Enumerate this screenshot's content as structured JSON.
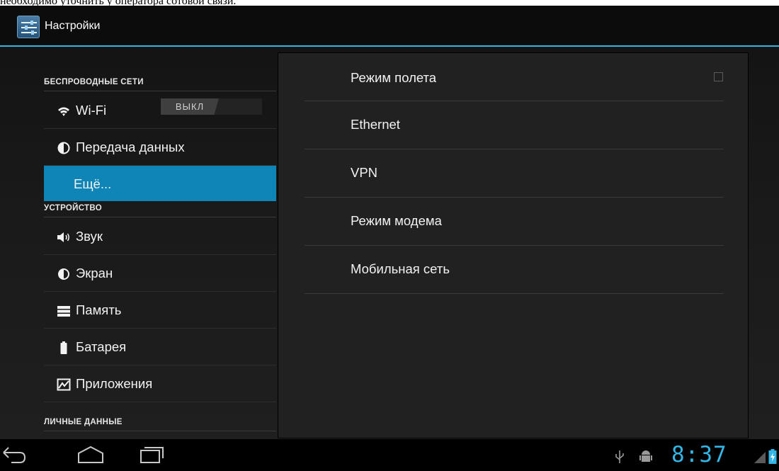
{
  "caption": "необходимо уточнить у оператора сотовой связи.",
  "app": {
    "title": "Настройки",
    "icon": "settings-icon"
  },
  "left": {
    "section_wireless": "БЕСПРОВОДНЫЕ СЕТИ",
    "wifi": {
      "label": "Wi-Fi",
      "toggle": "ВЫКЛ"
    },
    "data_usage": "Передача данных",
    "more": "Ещё...",
    "section_device": "УСТРОЙСТВО",
    "sound": "Звук",
    "display": "Экран",
    "storage": "Память",
    "battery": "Батарея",
    "apps": "Приложения",
    "section_personal": "ЛИЧНЫЕ ДАННЫЕ"
  },
  "right": {
    "items": [
      {
        "label": "Режим полета",
        "checked": false
      },
      {
        "label": "Ethernet"
      },
      {
        "label": "VPN"
      },
      {
        "label": "Режим модема"
      },
      {
        "label": "Мобильная сеть"
      }
    ]
  },
  "status": {
    "time": "8:37"
  },
  "colors": {
    "accent": "#33b5e5",
    "selected": "#0e85b6"
  }
}
